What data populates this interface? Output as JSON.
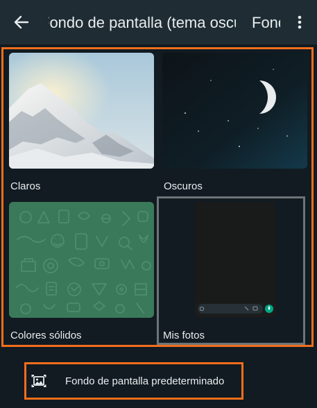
{
  "app_bar": {
    "back_icon": "arrow-left-icon",
    "title": "Fondo de pantalla (tema oscuro)",
    "right_text": "Fondo",
    "menu_icon": "more-vertical-icon"
  },
  "categories": [
    {
      "label": "Claros",
      "thumbnail": "snowy-mountain-peak"
    },
    {
      "label": "Oscuros",
      "thumbnail": "crescent-moon-night-sky"
    },
    {
      "label": "Colores sólidos",
      "thumbnail": "green-doodle-pattern"
    },
    {
      "label": "Mis fotos",
      "thumbnail": "dark-chat-preview",
      "selected": true
    }
  ],
  "default_button": {
    "label": "Fondo de pantalla predeterminado",
    "icon": "image-frame-icon"
  },
  "colors": {
    "background": "#121b22",
    "app_bar": "#1f2c34",
    "highlight": "#f26e1c",
    "selected_frame": "#6d7579",
    "solid_green": "#3a7a5a",
    "mic_green": "#00a884"
  }
}
